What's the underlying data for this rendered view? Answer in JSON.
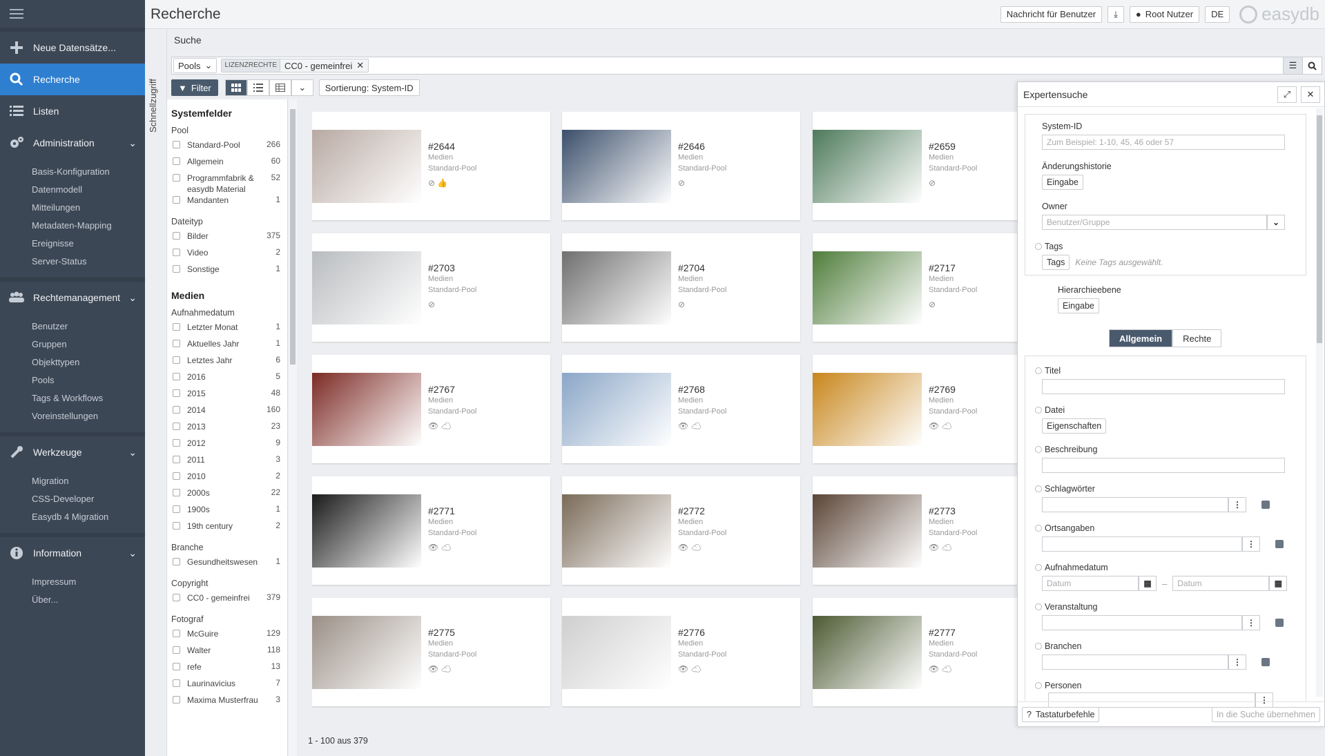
{
  "header": {
    "title": "Recherche",
    "nachricht_btn": "Nachricht für Benutzer",
    "user_btn": "Root Nutzer",
    "lang_btn": "DE",
    "logo": "easydb"
  },
  "sidebar": {
    "new": "Neue Datensätze...",
    "recherche": "Recherche",
    "listen": "Listen",
    "administration": "Administration",
    "admin_items": [
      "Basis-Konfiguration",
      "Datenmodell",
      "Mitteilungen",
      "Metadaten-Mapping",
      "Ereignisse",
      "Server-Status"
    ],
    "rechte": "Rechtemanagement",
    "rechte_items": [
      "Benutzer",
      "Gruppen",
      "Objekttypen",
      "Pools",
      "Tags & Workflows",
      "Voreinstellungen"
    ],
    "werkzeuge": "Werkzeuge",
    "werkzeuge_items": [
      "Migration",
      "CSS-Developer",
      "Easydb 4 Migration"
    ],
    "information": "Information",
    "info_items": [
      "Impressum",
      "Über..."
    ]
  },
  "schnellzugriff": "Schnellzugriff",
  "search": {
    "label": "Suche",
    "pools": "Pools",
    "chip_tag": "LIZENZRECHTE",
    "chip_value": "CC0 - gemeinfrei"
  },
  "toolbar": {
    "filter": "Filter",
    "sort": "Sortierung: System-ID"
  },
  "facets": {
    "systemfelder": "Systemfelder",
    "pool_label": "Pool",
    "pool": [
      [
        "Standard-Pool",
        "266"
      ],
      [
        "Allgemein",
        "60"
      ],
      [
        "Programmfabrik & easydb Material",
        "52"
      ],
      [
        "Mandanten",
        "1"
      ]
    ],
    "dateityp_label": "Dateityp",
    "dateityp": [
      [
        "Bilder",
        "375"
      ],
      [
        "Video",
        "2"
      ],
      [
        "Sonstige",
        "1"
      ]
    ],
    "medien": "Medien",
    "aufnahme_label": "Aufnahmedatum",
    "aufnahme": [
      [
        "Letzter Monat",
        "1"
      ],
      [
        "Aktuelles Jahr",
        "1"
      ],
      [
        "Letztes Jahr",
        "6"
      ],
      [
        "2016",
        "5"
      ],
      [
        "2015",
        "48"
      ],
      [
        "2014",
        "160"
      ],
      [
        "2013",
        "23"
      ],
      [
        "2012",
        "9"
      ],
      [
        "2011",
        "3"
      ],
      [
        "2010",
        "2"
      ],
      [
        "2000s",
        "22"
      ],
      [
        "1900s",
        "1"
      ],
      [
        "19th century",
        "2"
      ]
    ],
    "branche_label": "Branche",
    "branche": [
      [
        "Gesundheitswesen",
        "1"
      ]
    ],
    "copyright_label": "Copyright",
    "copyright": [
      [
        "CC0 - gemeinfrei",
        "379"
      ]
    ],
    "fotograf_label": "Fotograf",
    "fotograf": [
      [
        "McGuire",
        "129"
      ],
      [
        "Walter",
        "118"
      ],
      [
        "refe",
        "13"
      ],
      [
        "Laurinavicius",
        "7"
      ],
      [
        "Maxima Musterfrau",
        "3"
      ]
    ]
  },
  "cards": [
    {
      "id": "#2644",
      "type": "Medien",
      "pool": "Standard-Pool",
      "icons": "⊘ 👍",
      "color": "#b8a9a2"
    },
    {
      "id": "#2646",
      "type": "Medien",
      "pool": "Standard-Pool",
      "icons": "⊘",
      "color": "#3b4f6b"
    },
    {
      "id": "#2659",
      "type": "Medien",
      "pool": "Standard-Pool",
      "icons": "⊘",
      "color": "#4d7a5a"
    },
    {
      "id": "#2703",
      "type": "Medien",
      "pool": "Standard-Pool",
      "icons": "⊘",
      "color": "#b9bcbf"
    },
    {
      "id": "#2704",
      "type": "Medien",
      "pool": "Standard-Pool",
      "icons": "⊘",
      "color": "#6f6f6f"
    },
    {
      "id": "#2717",
      "type": "Medien",
      "pool": "Standard-Pool",
      "icons": "⊘",
      "color": "#4f7d3b"
    },
    {
      "id": "#2767",
      "type": "Medien",
      "pool": "Standard-Pool",
      "icons": "👁 ☁",
      "color": "#7c2a24"
    },
    {
      "id": "#2768",
      "type": "Medien",
      "pool": "Standard-Pool",
      "icons": "👁 ☁",
      "color": "#8aa6c7"
    },
    {
      "id": "#2769",
      "type": "Medien",
      "pool": "Standard-Pool",
      "icons": "👁 ☁",
      "color": "#c8861c"
    },
    {
      "id": "#2771",
      "type": "Medien",
      "pool": "Standard-Pool",
      "icons": "👁 ☁",
      "color": "#1a1a1a"
    },
    {
      "id": "#2772",
      "type": "Medien",
      "pool": "Standard-Pool",
      "icons": "👁 ☁",
      "color": "#7a6a58"
    },
    {
      "id": "#2773",
      "type": "Medien",
      "pool": "Standard-Pool",
      "icons": "👁 ☁",
      "color": "#5a4436"
    },
    {
      "id": "#2775",
      "type": "Medien",
      "pool": "Standard-Pool",
      "icons": "👁 ☁",
      "color": "#9a8f86"
    },
    {
      "id": "#2776",
      "type": "Medien",
      "pool": "Standard-Pool",
      "icons": "👁 ☁",
      "color": "#cfcfcf"
    },
    {
      "id": "#2777",
      "type": "Medien",
      "pool": "Standard-Pool",
      "icons": "👁 ☁",
      "color": "#4d5a33"
    }
  ],
  "pager": "1 - 100 aus 379",
  "expert": {
    "title": "Expertensuche",
    "system_id": "System-ID",
    "system_id_ph": "Zum Beispiel: 1-10, 45, 46 oder 57",
    "aenderung": "Änderungshistorie",
    "eingabe": "Eingabe",
    "owner": "Owner",
    "owner_ph": "Benutzer/Gruppe",
    "tags": "Tags",
    "tags_btn": "Tags",
    "tags_none": "Keine Tags ausgewählt.",
    "hierarchie": "Hierarchieebene",
    "tab_allgemein": "Allgemein",
    "tab_rechte": "Rechte",
    "titel": "Titel",
    "datei": "Datei",
    "eigenschaften": "Eigenschaften",
    "beschreibung": "Beschreibung",
    "schlagwoerter": "Schlagwörter",
    "ortsangaben": "Ortsangaben",
    "aufnahmedatum": "Aufnahmedatum",
    "datum": "Datum",
    "veranstaltung": "Veranstaltung",
    "branchen": "Branchen",
    "personen": "Personen",
    "tastatur": "Tastaturbefehle",
    "uebernehmen": "In die Suche übernehmen"
  }
}
